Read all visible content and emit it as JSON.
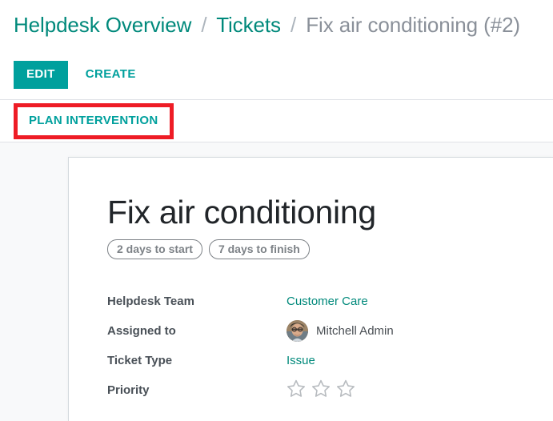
{
  "breadcrumb": {
    "items": [
      {
        "label": "Helpdesk Overview",
        "type": "link"
      },
      {
        "label": "Tickets",
        "type": "link"
      },
      {
        "label": "Fix air conditioning (#2)",
        "type": "current"
      }
    ],
    "separator": "/"
  },
  "control_panel": {
    "edit_label": "EDIT",
    "create_label": "CREATE",
    "plan_intervention_label": "PLAN INTERVENTION"
  },
  "record": {
    "title": "Fix air conditioning",
    "badges": [
      "2 days to start",
      "7 days to finish"
    ],
    "fields": [
      {
        "label": "Helpdesk Team",
        "value": "Customer Care",
        "kind": "link"
      },
      {
        "label": "Assigned to",
        "value": "Mitchell Admin",
        "kind": "user"
      },
      {
        "label": "Ticket Type",
        "value": "Issue",
        "kind": "link"
      },
      {
        "label": "Priority",
        "value": "",
        "kind": "stars",
        "stars_total": 3,
        "stars_filled": 0
      }
    ]
  },
  "colors": {
    "accent": "#00a09d",
    "link": "#00897b",
    "highlight": "#ee1c25",
    "muted": "#7d8287",
    "page_bg": "#f8f9fa"
  }
}
